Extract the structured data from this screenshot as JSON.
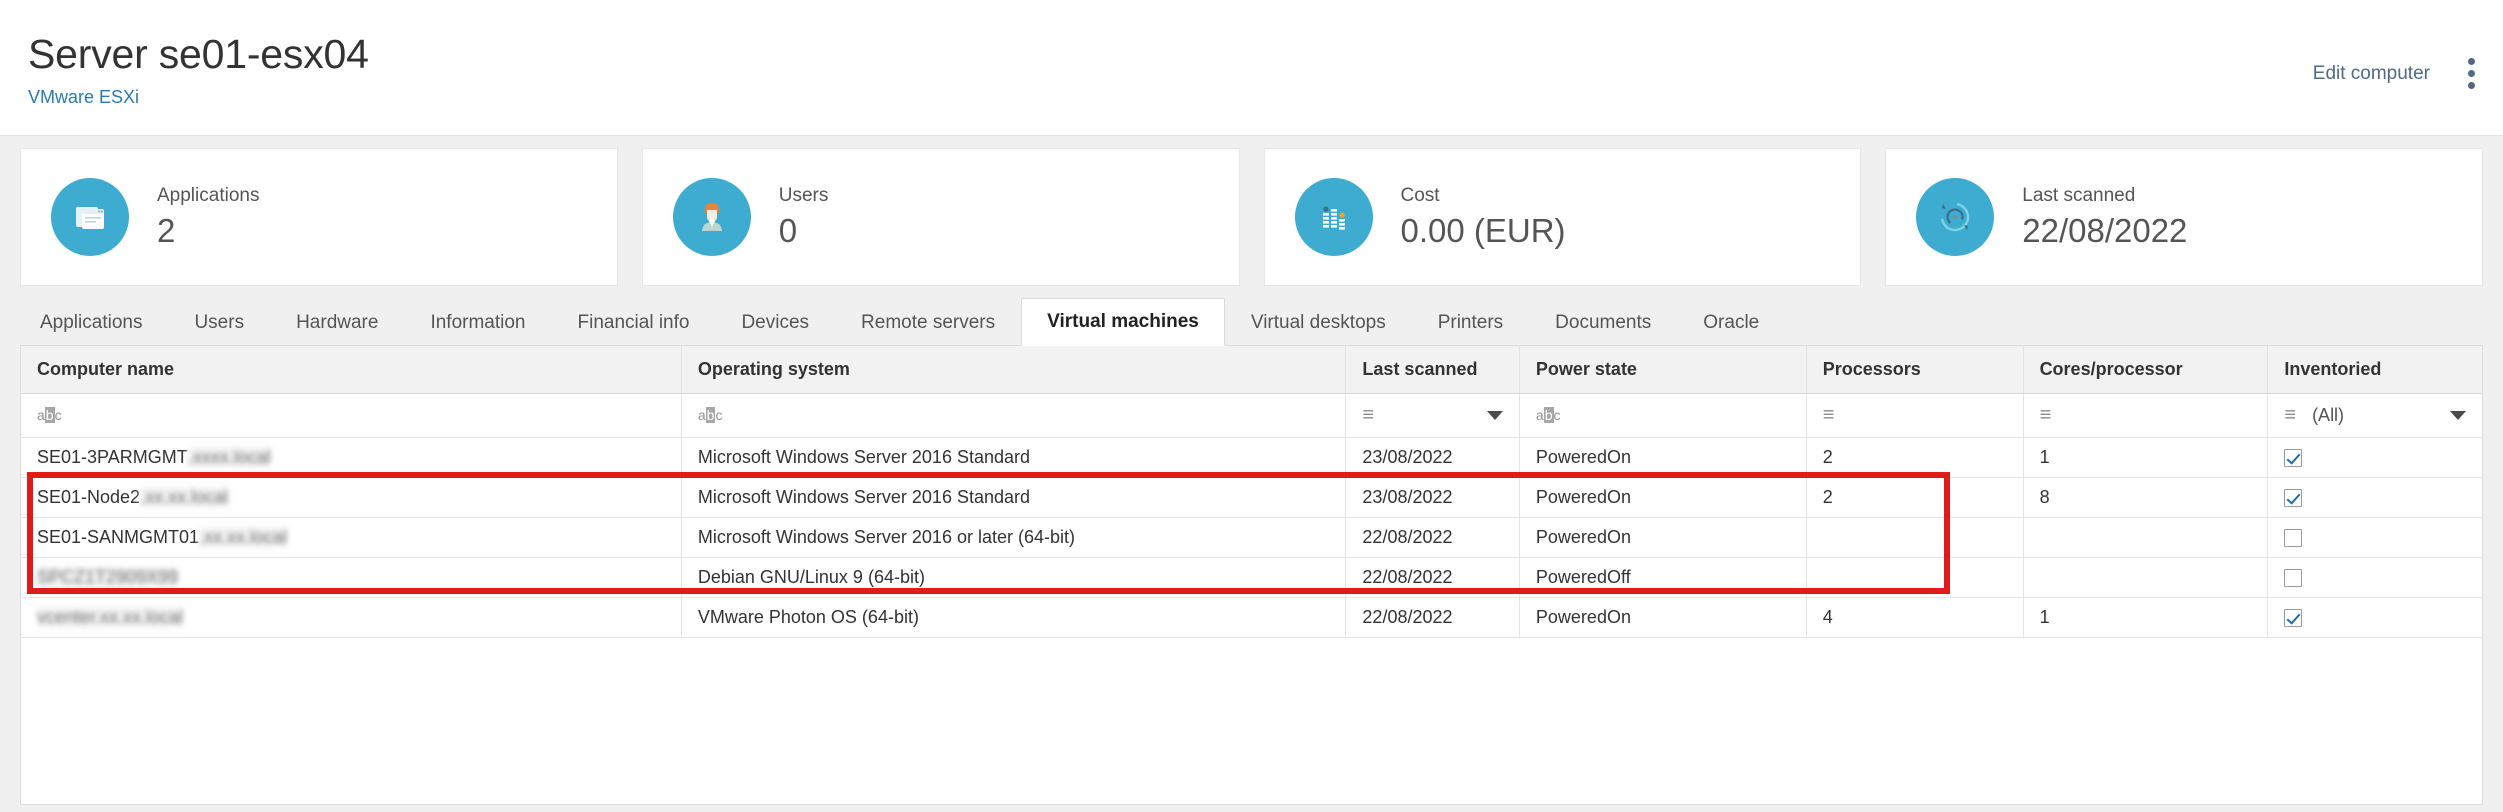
{
  "header": {
    "title": "Server se01-esx04",
    "subtitle": "VMware ESXi",
    "edit_label": "Edit computer",
    "more_icon": "kebab-menu-icon",
    "accent_color": "#2a7ab0"
  },
  "cards": [
    {
      "label": "Applications",
      "value": "2",
      "icon": "applications-icon",
      "icon_color": "#3dacd0"
    },
    {
      "label": "Users",
      "value": "0",
      "icon": "user-avatar-icon",
      "icon_color": "#3dacd0"
    },
    {
      "label": "Cost",
      "value": "0.00 (EUR)",
      "icon": "bar-chart-icon",
      "icon_color": "#3dacd0"
    },
    {
      "label": "Last scanned",
      "value": "22/08/2022",
      "icon": "refresh-icon",
      "icon_color": "#3dacd0"
    }
  ],
  "tabs": [
    {
      "label": "Applications",
      "active": false
    },
    {
      "label": "Users",
      "active": false
    },
    {
      "label": "Hardware",
      "active": false
    },
    {
      "label": "Information",
      "active": false
    },
    {
      "label": "Financial info",
      "active": false
    },
    {
      "label": "Devices",
      "active": false
    },
    {
      "label": "Remote servers",
      "active": false
    },
    {
      "label": "Virtual machines",
      "active": true
    },
    {
      "label": "Virtual desktops",
      "active": false
    },
    {
      "label": "Printers",
      "active": false
    },
    {
      "label": "Documents",
      "active": false
    },
    {
      "label": "Oracle",
      "active": false
    }
  ],
  "table": {
    "columns": [
      {
        "label": "Computer name",
        "filter": "abc",
        "align": "left"
      },
      {
        "label": "Operating system",
        "filter": "abc",
        "align": "left"
      },
      {
        "label": "Last scanned",
        "filter": "eq-dropdown",
        "align": "left"
      },
      {
        "label": "Power state",
        "filter": "abc",
        "align": "left"
      },
      {
        "label": "Processors",
        "filter": "eq",
        "align": "right"
      },
      {
        "label": "Cores/processor",
        "filter": "eq",
        "align": "right"
      },
      {
        "label": "Inventoried",
        "filter": "eq-select",
        "align": "center"
      }
    ],
    "inventoried_filter_value": "(All)",
    "rows": [
      {
        "computer_name": "SE01-3PARMGMT",
        "computer_name_redacted": ".xxxx.local",
        "name_blurred": false,
        "operating_system": "Microsoft Windows Server 2016 Standard",
        "last_scanned": "23/08/2022",
        "power_state": "PoweredOn",
        "processors": "2",
        "cores_per_processor": "1",
        "inventoried": true,
        "highlighted": true
      },
      {
        "computer_name": "SE01-Node2",
        "computer_name_redacted": ".xx.xx.local",
        "name_blurred": false,
        "operating_system": "Microsoft Windows Server 2016 Standard",
        "last_scanned": "23/08/2022",
        "power_state": "PoweredOn",
        "processors": "2",
        "cores_per_processor": "8",
        "inventoried": true,
        "highlighted": true
      },
      {
        "computer_name": "SE01-SANMGMT01",
        "computer_name_redacted": ".xx.xx.local",
        "name_blurred": false,
        "operating_system": "Microsoft Windows Server 2016 or later (64-bit)",
        "last_scanned": "22/08/2022",
        "power_state": "PoweredOn",
        "processors": "",
        "cores_per_processor": "",
        "inventoried": false,
        "highlighted": true
      },
      {
        "computer_name": "",
        "computer_name_redacted": "SPCZ1T2909X99",
        "name_blurred": true,
        "operating_system": "Debian GNU/Linux 9 (64-bit)",
        "last_scanned": "22/08/2022",
        "power_state": "PoweredOff",
        "processors": "",
        "cores_per_processor": "",
        "inventoried": false,
        "highlighted": false
      },
      {
        "computer_name": "",
        "computer_name_redacted": "vcenter.xx.xx.local",
        "name_blurred": true,
        "operating_system": "VMware Photon OS (64-bit)",
        "last_scanned": "22/08/2022",
        "power_state": "PoweredOn",
        "processors": "4",
        "cores_per_processor": "1",
        "inventoried": true,
        "highlighted": false
      }
    ]
  },
  "annotation": {
    "highlight_color": "#e01b1b",
    "name": "red-highlight-box"
  }
}
